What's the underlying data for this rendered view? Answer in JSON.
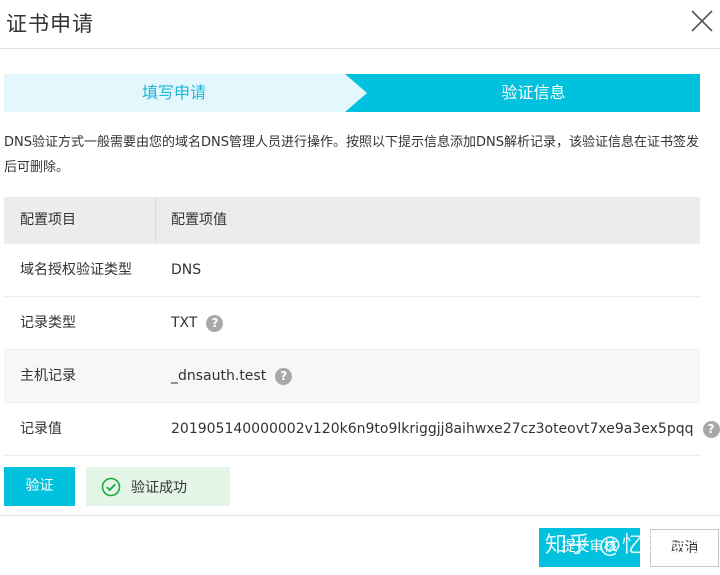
{
  "dialog": {
    "title": "证书申请"
  },
  "steps": [
    {
      "label": "填写申请",
      "state": "done"
    },
    {
      "label": "验证信息",
      "state": "active"
    }
  ],
  "description": "DNS验证方式一般需要由您的域名DNS管理人员进行操作。按照以下提示信息添加DNS解析记录，该验证信息在证书签发后可删除。",
  "table": {
    "headers": [
      "配置项目",
      "配置项值"
    ],
    "rows": [
      {
        "name": "域名授权验证类型",
        "value": "DNS",
        "help": false
      },
      {
        "name": "记录类型",
        "value": "TXT",
        "help": true
      },
      {
        "name": "主机记录",
        "value": "_dnsauth.test",
        "help": true
      },
      {
        "name": "记录值",
        "value": "201905140000002v120k6n9to9lkriggjj8aihwxe27cz3oteovt7xe9a3ex5pqq",
        "help": true
      }
    ]
  },
  "actions": {
    "verify_label": "验证",
    "success_text": "验证成功"
  },
  "footer": {
    "submit_label": "提交审核",
    "cancel_label": "取消"
  },
  "watermark": "知乎 @忆兰居士",
  "colors": {
    "accent": "#00c1de",
    "step_done_bg": "#e4f7fc",
    "success_bg": "#e3f5e7",
    "success_icon": "#1ca940"
  },
  "icons": {
    "close": "close-icon",
    "help": "help-icon",
    "success": "check-circle-icon"
  }
}
